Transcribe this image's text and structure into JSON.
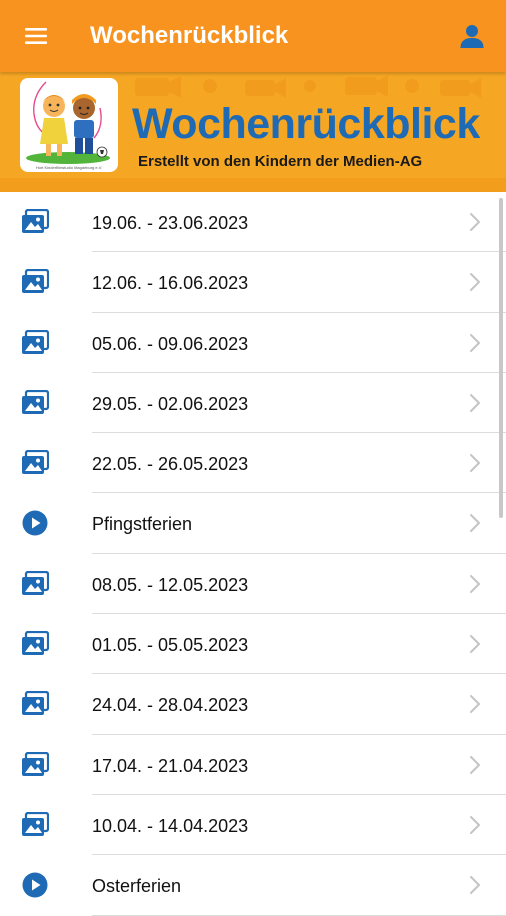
{
  "app_bar": {
    "title": "Wochenrückblick",
    "menu_icon": "menu-icon",
    "account_icon": "account-icon",
    "background_color": "#f7931e"
  },
  "banner": {
    "title": "Wochenrückblick",
    "subtitle": "Erstellt von den Kindern der Medien-AG",
    "logo_caption": "Hort Kinderfilmstudio Magdeburg e.V.",
    "title_color": "#1f6ab5",
    "background_color": "#f5a623"
  },
  "list": {
    "icon_color": "#1f6ab5",
    "items": [
      {
        "label": "19.06. - 23.06.2023",
        "icon": "gallery-icon"
      },
      {
        "label": "12.06. - 16.06.2023",
        "icon": "gallery-icon"
      },
      {
        "label": "05.06. - 09.06.2023",
        "icon": "gallery-icon"
      },
      {
        "label": "29.05. - 02.06.2023",
        "icon": "gallery-icon"
      },
      {
        "label": "22.05. - 26.05.2023",
        "icon": "gallery-icon"
      },
      {
        "label": "Pfingstferien",
        "icon": "play-icon"
      },
      {
        "label": "08.05. - 12.05.2023",
        "icon": "gallery-icon"
      },
      {
        "label": "01.05. - 05.05.2023",
        "icon": "gallery-icon"
      },
      {
        "label": "24.04. - 28.04.2023",
        "icon": "gallery-icon"
      },
      {
        "label": "17.04. - 21.04.2023",
        "icon": "gallery-icon"
      },
      {
        "label": "10.04. - 14.04.2023",
        "icon": "gallery-icon"
      },
      {
        "label": "Osterferien",
        "icon": "play-icon"
      }
    ]
  }
}
